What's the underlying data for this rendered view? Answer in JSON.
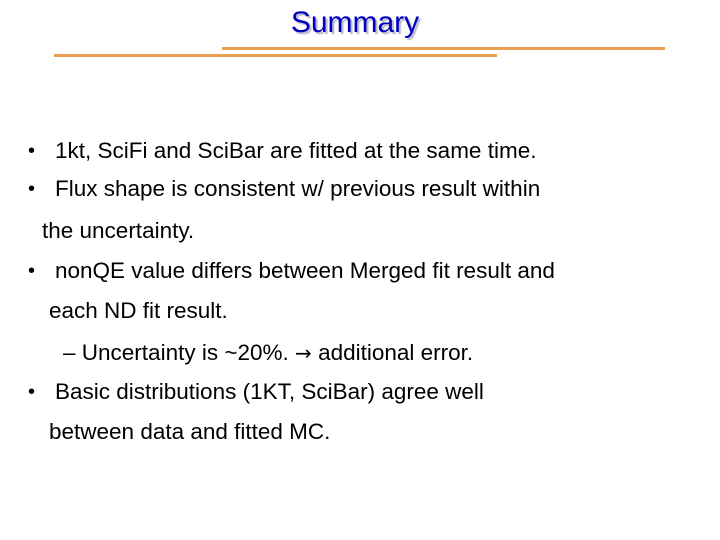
{
  "slide": {
    "title": "Summary",
    "accent_color": "#e8a050",
    "title_color": "#0000c0",
    "bullet_glyph": "•",
    "items": [
      {
        "lines": [
          "1kt, SciFi and SciBar are fitted at the same time."
        ]
      },
      {
        "lines": [
          "Flux shape is consistent w/ previous result within",
          "the uncertainty."
        ]
      },
      {
        "lines": [
          "nonQE value differs between Merged fit result and",
          "each ND fit result."
        ],
        "sub": {
          "dash": "–",
          "text_before_arrow": "Uncertainty is ~20%.",
          "arrow": "→",
          "text_after_arrow": "additional error."
        }
      },
      {
        "lines": [
          "Basic distributions (1KT, SciBar) agree well",
          "between data and fitted MC."
        ]
      }
    ]
  }
}
